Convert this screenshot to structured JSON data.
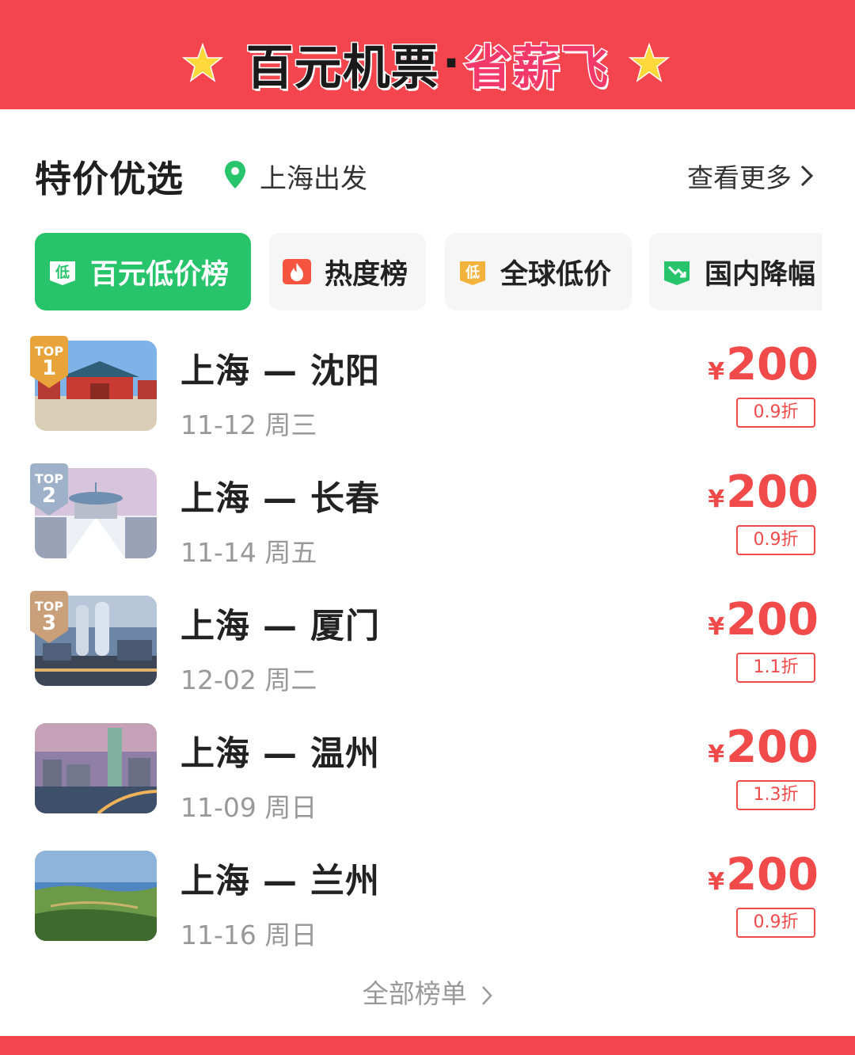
{
  "banner": {
    "title_main": "百元机票",
    "title_dot": "·",
    "title_accent": "省薪飞"
  },
  "header": {
    "title": "特价优选",
    "location": "上海出发",
    "more_label": "查看更多"
  },
  "tabs": [
    {
      "label": "百元低价榜",
      "icon": "low-price-tag-icon",
      "active": true
    },
    {
      "label": "热度榜",
      "icon": "flame-icon",
      "active": false
    },
    {
      "label": "全球低价",
      "icon": "low-price-tag-icon",
      "active": false
    },
    {
      "label": "国内降幅",
      "icon": "trend-down-icon",
      "active": false
    }
  ],
  "rank_top_label": "TOP",
  "currency_symbol": "¥",
  "items": [
    {
      "rank": "1",
      "route": "上海 — 沈阳",
      "date": "11-12 周三",
      "price": "200",
      "discount": "0.9折",
      "image": "palace-photo"
    },
    {
      "rank": "2",
      "route": "上海 — 长春",
      "date": "11-14 周五",
      "price": "200",
      "discount": "0.9折",
      "image": "snow-bridge-photo"
    },
    {
      "rank": "3",
      "route": "上海 — 厦门",
      "date": "12-02 周二",
      "price": "200",
      "discount": "1.1折",
      "image": "city-towers-photo"
    },
    {
      "rank": "",
      "route": "上海 — 温州",
      "date": "11-09 周日",
      "price": "200",
      "discount": "1.3折",
      "image": "river-city-photo"
    },
    {
      "rank": "",
      "route": "上海 — 兰州",
      "date": "11-16 周日",
      "price": "200",
      "discount": "0.9折",
      "image": "landscape-photo"
    }
  ],
  "footer": {
    "all_list_label": "全部榜单"
  },
  "colors": {
    "brand_red": "#f4454f",
    "accent_green": "#27c46c",
    "price_red": "#f04a4a",
    "gold": "#e8a43a",
    "silver": "#9fb1c8",
    "bronze": "#c9a07a"
  }
}
